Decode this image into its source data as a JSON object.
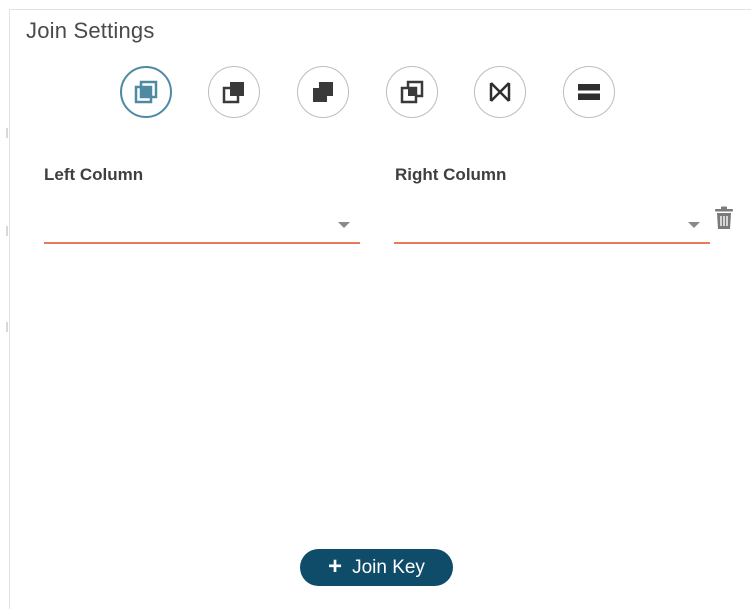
{
  "panel": {
    "title": "Join Settings"
  },
  "join_types": [
    {
      "name": "inner-join",
      "icon": "inner-join-icon",
      "selected": true
    },
    {
      "name": "left-join",
      "icon": "left-join-icon",
      "selected": false
    },
    {
      "name": "right-join",
      "icon": "right-join-icon",
      "selected": false
    },
    {
      "name": "full-outer-join",
      "icon": "full-outer-join-icon",
      "selected": false
    },
    {
      "name": "natural-join",
      "icon": "bowtie-icon",
      "selected": false
    },
    {
      "name": "union",
      "icon": "union-bars-icon",
      "selected": false
    }
  ],
  "columns": {
    "left_label": "Left Column",
    "left_value": "",
    "right_label": "Right Column",
    "right_value": ""
  },
  "actions": {
    "add_join_key": "Join Key",
    "delete_icon": "trash-icon"
  },
  "colors": {
    "accent": "#4f8aa3",
    "underline": "#e57b5b",
    "button_bg": "#0f4c6a",
    "icon_dark": "#3a3a3a"
  }
}
